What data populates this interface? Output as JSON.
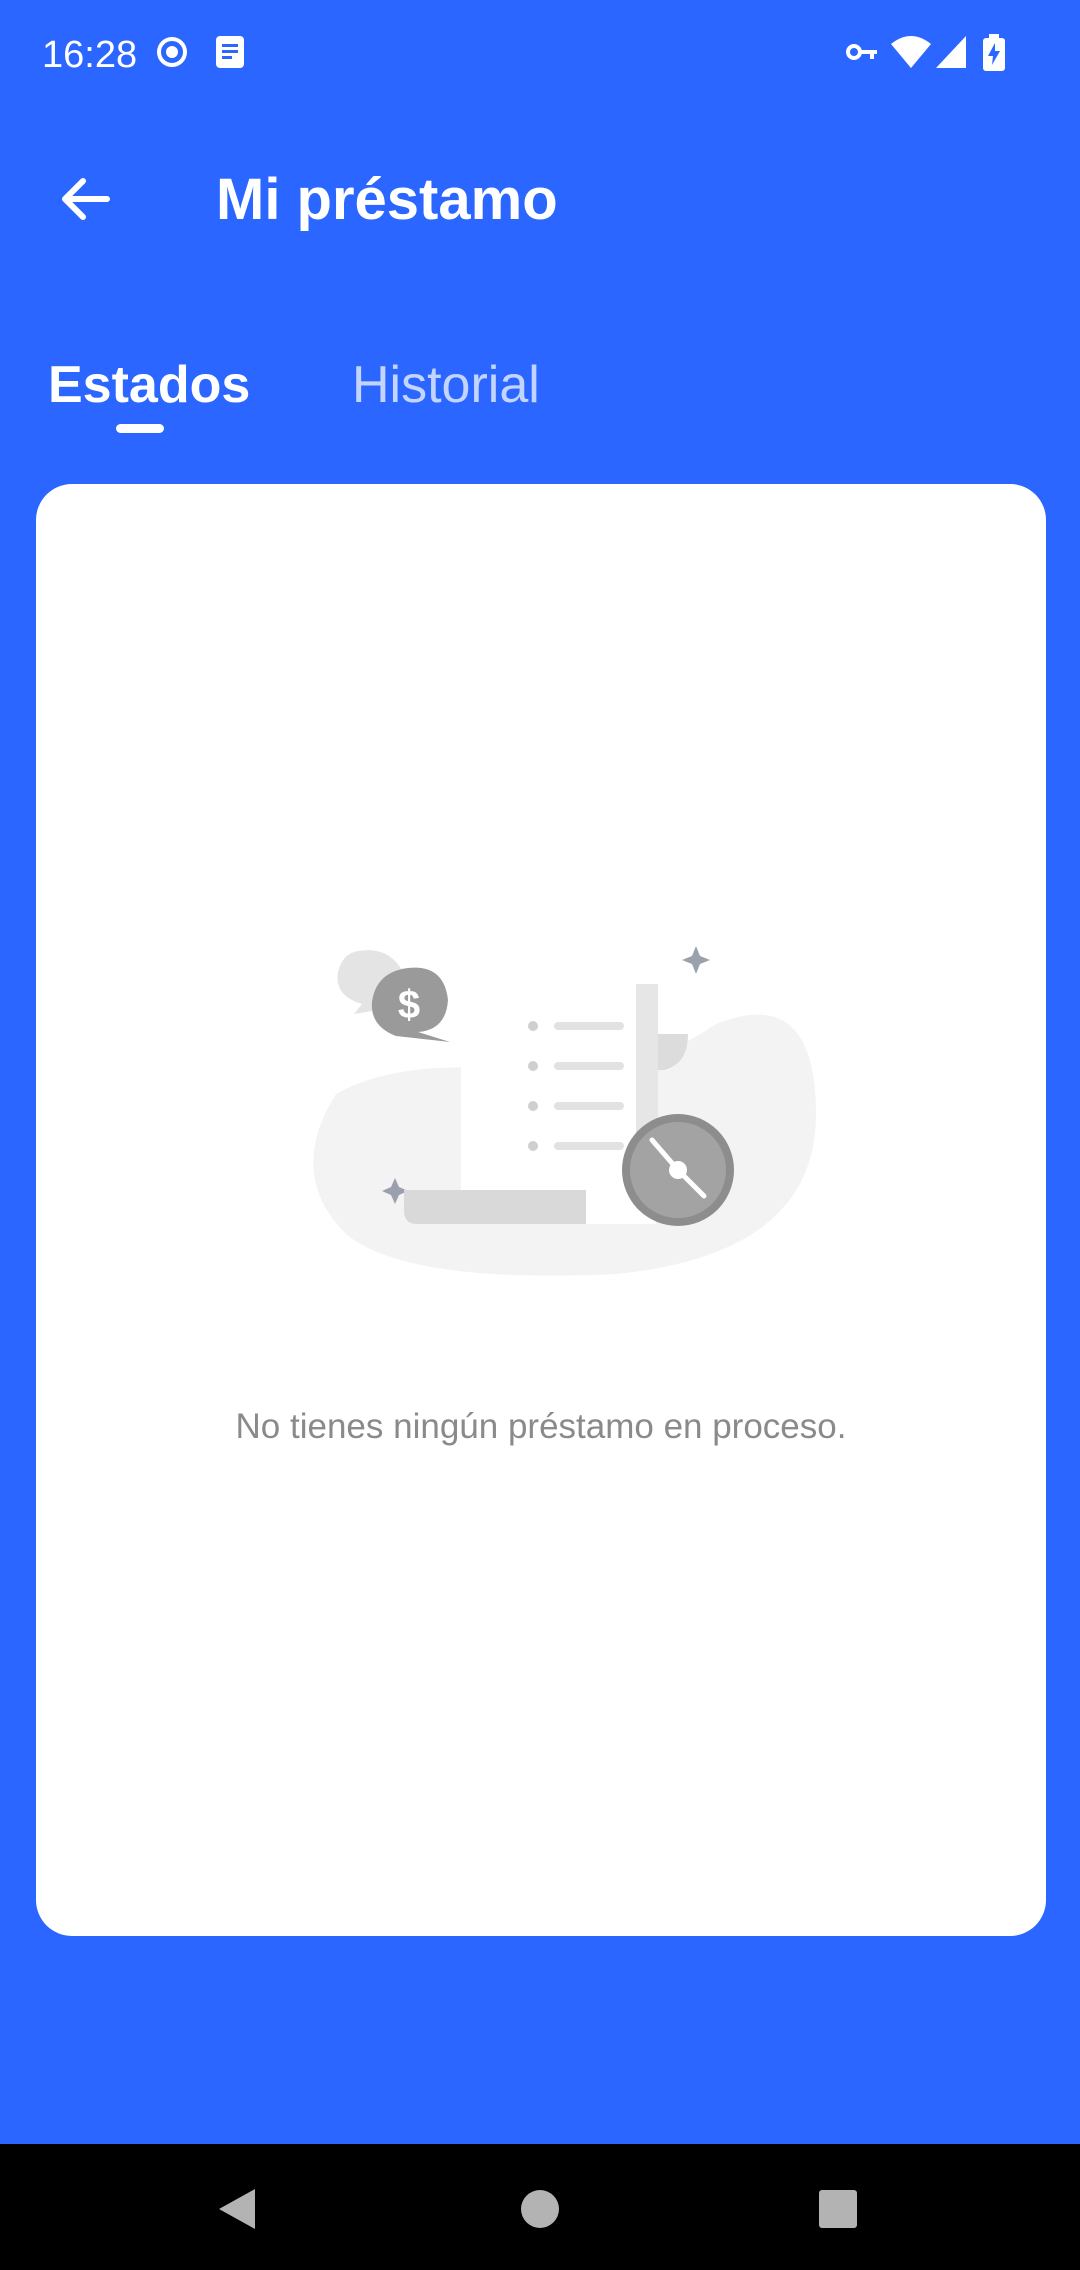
{
  "status_bar": {
    "time": "16:28",
    "left_icons": [
      "record-icon",
      "notes-icon"
    ],
    "right_icons": [
      "vpn-key-icon",
      "wifi-icon",
      "signal-icon",
      "battery-charging-icon"
    ]
  },
  "header": {
    "title": "Mi préstamo",
    "back_icon": "arrow-left-icon"
  },
  "tabs": [
    {
      "label": "Estados",
      "active": true
    },
    {
      "label": "Historial",
      "active": false
    }
  ],
  "empty_state": {
    "message": "No tienes ningún préstamo en proceso.",
    "illustration_icons": [
      "chat-dollar-icon",
      "document-list-icon",
      "clock-icon"
    ]
  },
  "nav_bar": {
    "buttons": [
      "back-triangle-icon",
      "home-circle-icon",
      "recents-square-icon"
    ]
  },
  "colors": {
    "primary": "#2a66ff",
    "card": "#ffffff",
    "empty_text": "#8a8a8a",
    "nav_bar": "#000000"
  }
}
